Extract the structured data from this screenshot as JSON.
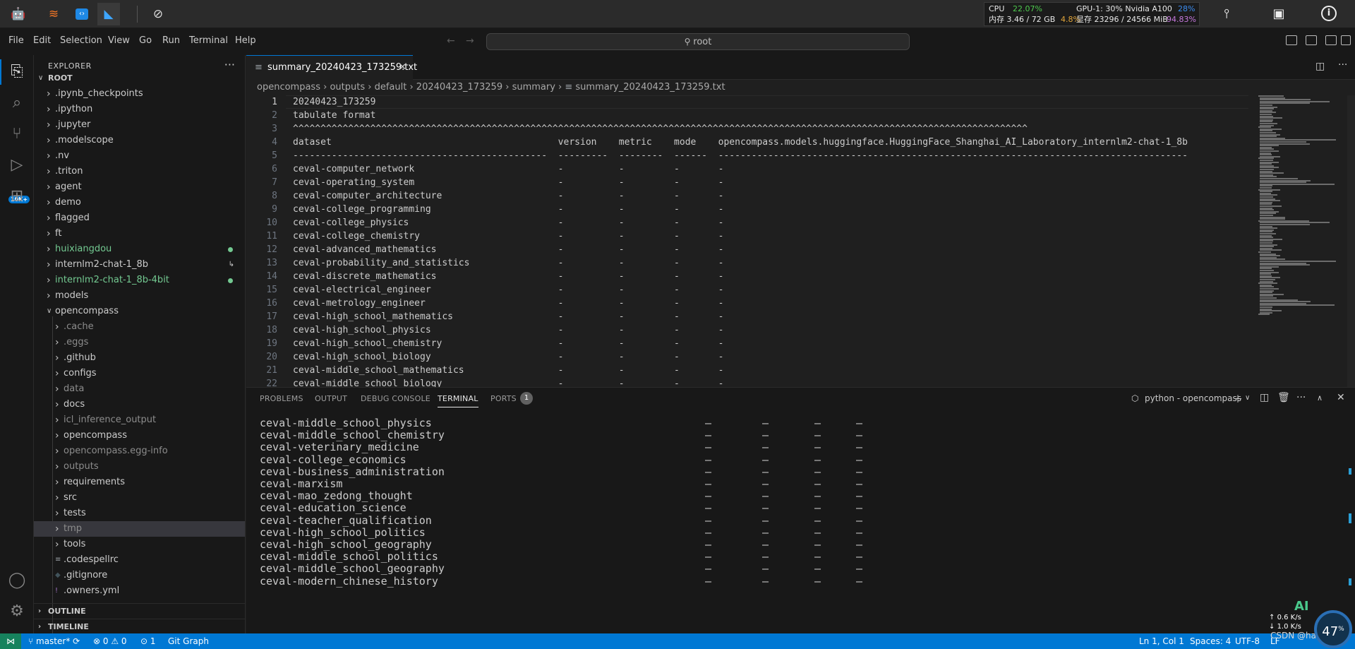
{
  "topbar": {
    "stats": {
      "cpu_label": "CPU",
      "cpu_value": "22.07%",
      "mem_label": "内存 3.46 / 72 GB",
      "mem_value": "4.8%",
      "gpu_label": "GPU-1: 30% Nvidia A100",
      "gpu_value": "28%",
      "vram_label": "显存 23296 / 24566 MiB",
      "vram_value": "94.83%"
    },
    "icons": [
      "bot-icon",
      "jupyter-icon",
      "vscode-blue-icon",
      "vscode-icon",
      "compass-icon"
    ]
  },
  "menu": [
    "File",
    "Edit",
    "Selection",
    "View",
    "Go",
    "Run",
    "Terminal",
    "Help"
  ],
  "command_center": "root",
  "explorer": {
    "title": "EXPLORER",
    "root": "ROOT",
    "items": [
      {
        "label": ".ipynb_checkpoints",
        "level": 1,
        "open": false,
        "type": "folder",
        "color": "#cccccc"
      },
      {
        "label": ".ipython",
        "level": 1,
        "open": false,
        "type": "folder",
        "color": "#cccccc"
      },
      {
        "label": ".jupyter",
        "level": 1,
        "open": false,
        "type": "folder",
        "color": "#cccccc"
      },
      {
        "label": ".modelscope",
        "level": 1,
        "open": false,
        "type": "folder",
        "color": "#cccccc"
      },
      {
        "label": ".nv",
        "level": 1,
        "open": false,
        "type": "folder",
        "color": "#cccccc"
      },
      {
        "label": ".triton",
        "level": 1,
        "open": false,
        "type": "folder",
        "color": "#cccccc"
      },
      {
        "label": "agent",
        "level": 1,
        "open": false,
        "type": "folder",
        "color": "#cccccc"
      },
      {
        "label": "demo",
        "level": 1,
        "open": false,
        "type": "folder",
        "color": "#cccccc"
      },
      {
        "label": "flagged",
        "level": 1,
        "open": false,
        "type": "folder",
        "color": "#cccccc"
      },
      {
        "label": "ft",
        "level": 1,
        "open": false,
        "type": "folder",
        "color": "#cccccc"
      },
      {
        "label": "huixiangdou",
        "level": 1,
        "open": false,
        "type": "folder",
        "color": "#73c991",
        "dot": true
      },
      {
        "label": "internlm2-chat-1_8b",
        "level": 1,
        "open": false,
        "type": "folder",
        "color": "#cccccc",
        "link": true
      },
      {
        "label": "internlm2-chat-1_8b-4bit",
        "level": 1,
        "open": false,
        "type": "folder",
        "color": "#73c991",
        "dot": true
      },
      {
        "label": "models",
        "level": 1,
        "open": false,
        "type": "folder",
        "color": "#cccccc"
      },
      {
        "label": "opencompass",
        "level": 1,
        "open": true,
        "type": "folder",
        "color": "#cccccc"
      },
      {
        "label": ".cache",
        "level": 2,
        "open": false,
        "type": "folder",
        "color": "#8c8c8c"
      },
      {
        "label": ".eggs",
        "level": 2,
        "open": false,
        "type": "folder",
        "color": "#8c8c8c"
      },
      {
        "label": ".github",
        "level": 2,
        "open": false,
        "type": "folder",
        "color": "#cccccc"
      },
      {
        "label": "configs",
        "level": 2,
        "open": false,
        "type": "folder",
        "color": "#cccccc"
      },
      {
        "label": "data",
        "level": 2,
        "open": false,
        "type": "folder",
        "color": "#8c8c8c"
      },
      {
        "label": "docs",
        "level": 2,
        "open": false,
        "type": "folder",
        "color": "#cccccc"
      },
      {
        "label": "icl_inference_output",
        "level": 2,
        "open": false,
        "type": "folder",
        "color": "#8c8c8c"
      },
      {
        "label": "opencompass",
        "level": 2,
        "open": false,
        "type": "folder",
        "color": "#cccccc"
      },
      {
        "label": "opencompass.egg-info",
        "level": 2,
        "open": false,
        "type": "folder",
        "color": "#8c8c8c"
      },
      {
        "label": "outputs",
        "level": 2,
        "open": false,
        "type": "folder",
        "color": "#8c8c8c"
      },
      {
        "label": "requirements",
        "level": 2,
        "open": false,
        "type": "folder",
        "color": "#cccccc"
      },
      {
        "label": "src",
        "level": 2,
        "open": false,
        "type": "folder",
        "color": "#cccccc"
      },
      {
        "label": "tests",
        "level": 2,
        "open": false,
        "type": "folder",
        "color": "#cccccc"
      },
      {
        "label": "tmp",
        "level": 2,
        "open": false,
        "type": "folder",
        "color": "#8c8c8c",
        "selected": true
      },
      {
        "label": "tools",
        "level": 2,
        "open": false,
        "type": "folder",
        "color": "#cccccc"
      },
      {
        "label": ".codespellrc",
        "level": 2,
        "type": "file",
        "color": "#cccccc",
        "icon": "≡"
      },
      {
        "label": ".gitignore",
        "level": 2,
        "type": "file",
        "color": "#cccccc",
        "icon": "◆"
      },
      {
        "label": ".owners.yml",
        "level": 2,
        "type": "file",
        "color": "#cccccc",
        "icon": "!"
      }
    ],
    "outline": "OUTLINE",
    "timeline": "TIMELINE"
  },
  "editor": {
    "tab": "summary_20240423_173259.txt",
    "breadcrumb": [
      "opencompass",
      "outputs",
      "default",
      "20240423_173259",
      "summary",
      "summary_20240423_173259.txt"
    ],
    "lines": [
      "20240423_173259",
      "tabulate format",
      "^^^^^^^^^^^^^^^^^^^^^^^^^^^^^^^^^^^^^^^^^^^^^^^^^^^^^^^^^^^^^^^^^^^^^^^^^^^^^^^^^^^^^^^^^^^^^^^^^^^^^^^^^^^^^^^^^^^^^^^^^^^^^^^^^^^^^",
      "dataset                                         version    metric    mode    opencompass.models.huggingface.HuggingFace_Shanghai_AI_Laboratory_internlm2-chat-1_8b",
      "----------------------------------------------  ---------  --------  ------  -------------------------------------------------------------------------------------",
      "ceval-computer_network                          -          -         -       -",
      "ceval-operating_system                          -          -         -       -",
      "ceval-computer_architecture                     -          -         -       -",
      "ceval-college_programming                       -          -         -       -",
      "ceval-college_physics                           -          -         -       -",
      "ceval-college_chemistry                         -          -         -       -",
      "ceval-advanced_mathematics                      -          -         -       -",
      "ceval-probability_and_statistics                -          -         -       -",
      "ceval-discrete_mathematics                      -          -         -       -",
      "ceval-electrical_engineer                       -          -         -       -",
      "ceval-metrology_engineer                        -          -         -       -",
      "ceval-high_school_mathematics                   -          -         -       -",
      "ceval-high_school_physics                       -          -         -       -",
      "ceval-high_school_chemistry                     -          -         -       -",
      "ceval-high_school_biology                       -          -         -       -",
      "ceval-middle_school_mathematics                 -          -         -       -",
      "ceval-middle_school_biology                     -          -         -       -"
    ]
  },
  "panel": {
    "tabs": [
      "PROBLEMS",
      "OUTPUT",
      "DEBUG CONSOLE",
      "TERMINAL",
      "PORTS"
    ],
    "active_tab": "TERMINAL",
    "ports_count": "1",
    "terminal_name": "python - opencompass",
    "terminal_lines": [
      "ceval-middle_school_physics",
      "ceval-middle_school_chemistry",
      "ceval-veterinary_medicine",
      "ceval-college_economics",
      "ceval-business_administration",
      "ceval-marxism",
      "ceval-mao_zedong_thought",
      "ceval-education_science",
      "ceval-teacher_qualification",
      "ceval-high_school_politics",
      "ceval-high_school_geography",
      "ceval-middle_school_politics",
      "ceval-middle_school_geography",
      "ceval-modern_chinese_history"
    ],
    "dash": "—"
  },
  "status": {
    "branch": "master*",
    "errors": "0",
    "warnings": "0",
    "ports": "1",
    "git_graph": "Git Graph",
    "position": "Ln 1, Col 1",
    "spaces": "Spaces: 4",
    "encoding": "UTF-8",
    "eol": "LF",
    "watermark": "CSDN @haidizym",
    "net_up": "0.6 K/s",
    "net_down": "1.0 K/s",
    "gauge": "47",
    "ai_label": "AI"
  },
  "colors": {
    "accent": "#0078d4",
    "git_added": "#73c991",
    "cpu": "#4ec94e",
    "mem": "#e2a53a",
    "gpu": "#3d8df0",
    "vram": "#c678dd"
  }
}
